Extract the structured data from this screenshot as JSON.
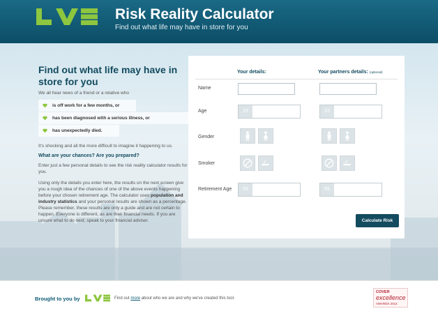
{
  "header": {
    "title": "Risk Reality Calculator",
    "subtitle": "Find out what life may have in store for you"
  },
  "intro": {
    "heading": "Find out what life may have in store for you",
    "lead": "We all hear news of a friend or a relative who",
    "bullets": [
      "is off work for a few months, or",
      "has been diagnosed with a serious illness, or",
      "has unexpectedly died."
    ],
    "shock": "It's shocking and all the more difficult to imagine it happening to us.",
    "question": "What are your chances? Are you prepared?",
    "enter": "Enter just a few personal details to see the risk reality calculator results for you.",
    "using": {
      "before": "Using only the details you enter here, the results on the next screen give you a rough idea of the chances of one of the above events happening before your chosen retirement age. The calculator uses ",
      "bold": "population and industry statistics",
      "after": " and your personal results are shown as a percentage. Please remember, these results are only a guide and are not certain to happen. Everyone is different, as are their financial needs. If you are unsure what to do next, speak to your financial adviser."
    }
  },
  "form": {
    "your_details": "Your details:",
    "partner_details": "Your partners details:",
    "optional": "(optional)",
    "labels": {
      "name": "Name",
      "age": "Age",
      "gender": "Gender",
      "smoker": "Smoker",
      "retirement_age": "Retirement Age"
    },
    "you": {
      "age": "23",
      "retirement_age": "55"
    },
    "partner": {
      "age": "23",
      "retirement_age": "55"
    },
    "calculate_label": "Calculate Risk"
  },
  "footer": {
    "brought_by": "Brought to you by",
    "find_before": "Find out ",
    "find_link": "more",
    "find_after": " about who we are and why we've created this tool.",
    "award_line1": "COVER",
    "award_line2": "excellence",
    "award_line3": "AWARDS 2014"
  },
  "colors": {
    "header": "#0c4d66",
    "accent_green": "#8dc63f",
    "heading": "#134b5f",
    "button": "#134b5f"
  },
  "icons": [
    "heart-icon",
    "male-icon",
    "female-icon",
    "no-smoking-icon",
    "smoking-icon"
  ]
}
